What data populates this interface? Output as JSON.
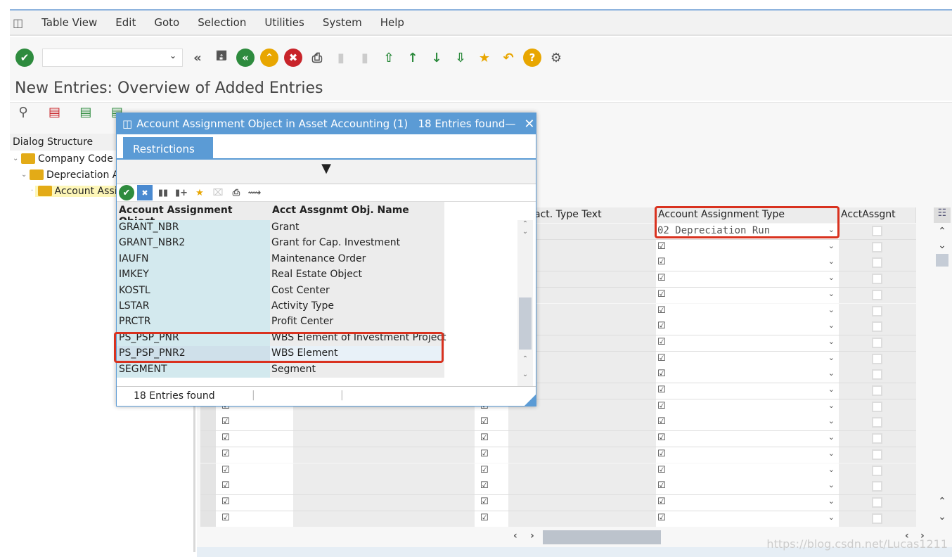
{
  "menu": [
    "Table View",
    "Edit",
    "Goto",
    "Selection",
    "Utilities",
    "System",
    "Help"
  ],
  "page_title": "New Entries: Overview of Added Entries",
  "dialog_structure": {
    "header": "Dialog Structure",
    "items": [
      "Company Code",
      "Depreciation Area",
      "Account Assignment Object"
    ]
  },
  "grid": {
    "headers": [
      "Transact. Type Text",
      "Account Assignment Type",
      "AcctAssgnt"
    ],
    "first_row_type": "02 Depreciation Run",
    "row_count": 19
  },
  "popup": {
    "title": "Account Assignment Object in Asset Accounting (1)   18 Entries found",
    "tab": "Restrictions",
    "columns": [
      "Account Assignment Object",
      "Acct Assgnmt Obj. Name"
    ],
    "rows": [
      [
        "GRANT_NBR",
        "Grant"
      ],
      [
        "GRANT_NBR2",
        "Grant for Cap. Investment"
      ],
      [
        "IAUFN",
        "Maintenance Order"
      ],
      [
        "IMKEY",
        "Real Estate Object"
      ],
      [
        "KOSTL",
        "Cost Center"
      ],
      [
        "LSTAR",
        "Activity Type"
      ],
      [
        "PRCTR",
        "Profit Center"
      ],
      [
        "PS_PSP_PNR",
        "WBS Element of Investment Project"
      ],
      [
        "PS_PSP_PNR2",
        "WBS Element"
      ],
      [
        "SEGMENT",
        "Segment"
      ]
    ],
    "status": "18 Entries found"
  },
  "watermark": "https://blog.csdn.net/Lucas1211",
  "colors": {
    "accent": "#5b9bd5",
    "highlight": "#d9321f",
    "green": "#2e8b3e",
    "yellow": "#e8a600",
    "red": "#c8242a"
  }
}
